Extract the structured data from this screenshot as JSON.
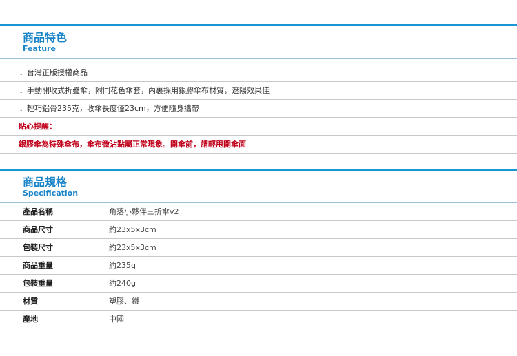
{
  "feature": {
    "title": "商品特色",
    "subtitle": "Feature",
    "items": [
      "．台灣正版授權商品",
      "．手動開收式折疊傘，附同花色傘套，內裏採用銀膠傘布材質，遮陽效果佳",
      "．輕巧鋁骨235克，收傘長度僅23cm，方便隨身攜帶"
    ],
    "tip_label": "貼心提醒：",
    "tip_text": "銀膠傘為特殊傘布，傘布微沾黏屬正常現象。開傘前，請輕甩開傘面"
  },
  "spec": {
    "title": "商品規格",
    "subtitle": "Specification",
    "rows": [
      {
        "key": "產品名稱",
        "value": "角落小夥伴三折傘v2"
      },
      {
        "key": "商品尺寸",
        "value": "約23x5x3cm"
      },
      {
        "key": "包裝尺寸",
        "value": "約23x5x3cm"
      },
      {
        "key": "商品重量",
        "value": "約235g"
      },
      {
        "key": "包裝重量",
        "value": "約240g"
      },
      {
        "key": "材質",
        "value": "塑膠、鐵"
      },
      {
        "key": "產地",
        "value": "中國"
      }
    ]
  },
  "colors": {
    "accent": "#1a96d4",
    "heading": "#1a84c8",
    "warning": "#c0001a"
  }
}
